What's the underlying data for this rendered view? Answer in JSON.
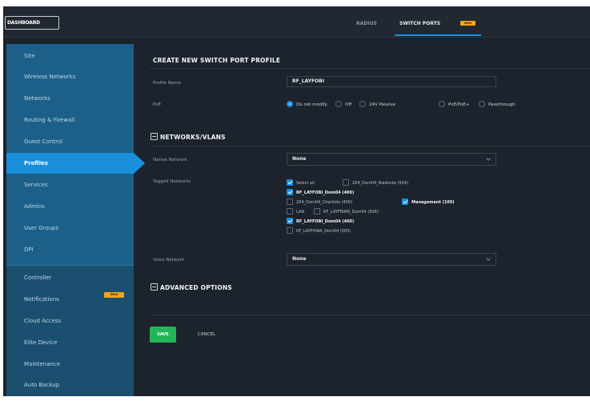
{
  "topbar": {
    "dashboard_label": "DASHBOARD",
    "tabs": [
      {
        "label": "RADIUS",
        "active": false
      },
      {
        "label": "SWITCH PORTS",
        "active": true,
        "badge": "NEW"
      }
    ]
  },
  "sidebar": {
    "items": [
      {
        "label": "Site"
      },
      {
        "label": "Wireless Networks"
      },
      {
        "label": "Networks"
      },
      {
        "label": "Routing & Firewall"
      },
      {
        "label": "Guest Control"
      },
      {
        "label": "Profiles",
        "active": true
      },
      {
        "label": "Services"
      },
      {
        "label": "Admins"
      },
      {
        "label": "User Groups"
      },
      {
        "label": "DPI"
      },
      {
        "label": "Controller"
      },
      {
        "label": "Notifications",
        "badge": "NEW"
      },
      {
        "label": "Cloud Access"
      },
      {
        "label": "Elite Device"
      },
      {
        "label": "Maintenance"
      },
      {
        "label": "Auto Backup"
      }
    ]
  },
  "form": {
    "title": "CREATE NEW SWITCH PORT PROFILE",
    "profile_name_label": "Profile Name",
    "profile_name_value": "RF_LAYFOBI",
    "poe_label": "PoE",
    "poe_options": [
      {
        "label": "Do not modify",
        "selected": true
      },
      {
        "label": "Off",
        "selected": false
      },
      {
        "label": "24V Passive",
        "selected": false
      },
      {
        "label": "PoE/PoE+",
        "selected": false
      },
      {
        "label": "Passthrough",
        "selected": false
      }
    ],
    "networks_section": "NETWORKS/VLANS",
    "native_label": "Native Network",
    "native_value": "None",
    "tagged_label": "Tagged Networks",
    "tagged": [
      {
        "label": "Select all",
        "checked": true,
        "bold": false
      },
      {
        "label": "204_Dom04_Nwdonte (504)",
        "checked": false,
        "bold": false
      },
      {
        "label": "RF_LAYFOBI_Dom04 (400)",
        "checked": true,
        "bold": true
      },
      {
        "label": "204_Dom04_Chartists (450)",
        "checked": false,
        "bold": false
      },
      {
        "label": "Management (100)",
        "checked": true,
        "bold": true
      },
      {
        "label": "LAN",
        "checked": false,
        "bold": false
      },
      {
        "label": "RF_LAYFNWN_Dom04 (506)",
        "checked": false,
        "bold": false
      },
      {
        "label": "RF_LAYFOBI_Dom04 (400)",
        "checked": true,
        "bold": true
      },
      {
        "label": "RF_LAYFHWA_Dom04 (505)",
        "checked": false,
        "bold": false
      }
    ],
    "voice_label": "Voice Network",
    "voice_value": "None",
    "advanced_section": "ADVANCED OPTIONS",
    "save_label": "SAVE",
    "cancel_label": "CANCEL"
  },
  "colors": {
    "accent": "#1a8fdc",
    "save": "#22b558",
    "badge": "#f2a41c",
    "sidebar": "#1c6089",
    "background": "#1d232c"
  }
}
